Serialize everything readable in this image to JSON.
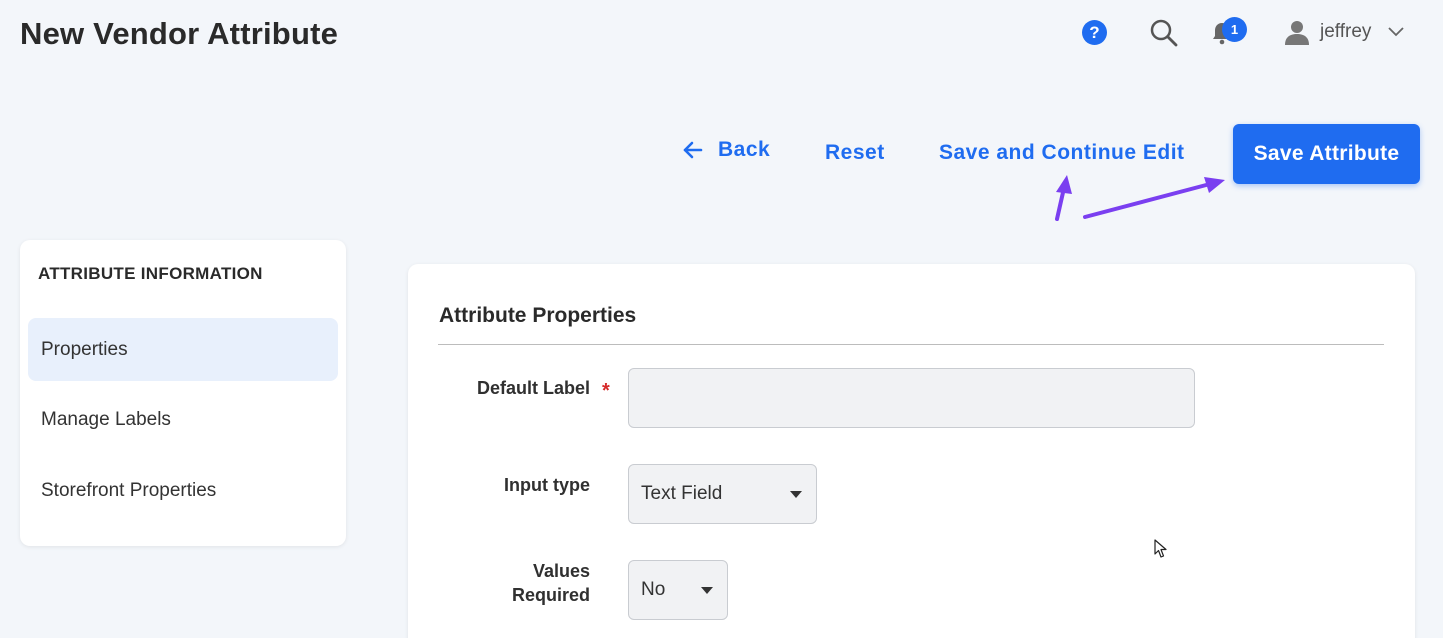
{
  "page": {
    "title": "New Vendor Attribute"
  },
  "header": {
    "help_icon": "?",
    "notification_count": "1",
    "user_name": "jeffrey"
  },
  "actions": {
    "back_label": "Back",
    "reset_label": "Reset",
    "save_continue_label": "Save and Continue Edit",
    "save_attribute_label": "Save Attribute"
  },
  "sidebar": {
    "title": "ATTRIBUTE INFORMATION",
    "items": [
      {
        "label": "Properties",
        "active": true
      },
      {
        "label": "Manage Labels",
        "active": false
      },
      {
        "label": "Storefront Properties",
        "active": false
      }
    ]
  },
  "form": {
    "section_title": "Attribute Properties",
    "required_mark": "*",
    "fields": {
      "default_label": {
        "label": "Default Label",
        "value": ""
      },
      "input_type": {
        "label": "Input type",
        "value": "Text Field"
      },
      "values_required": {
        "label_line1": "Values",
        "label_line2": "Required",
        "value": "No"
      }
    }
  },
  "colors": {
    "accent": "#1f6cf0",
    "annotation_arrow": "#7a3ff0",
    "required": "#d62a2a",
    "background": "#f3f6fa"
  }
}
